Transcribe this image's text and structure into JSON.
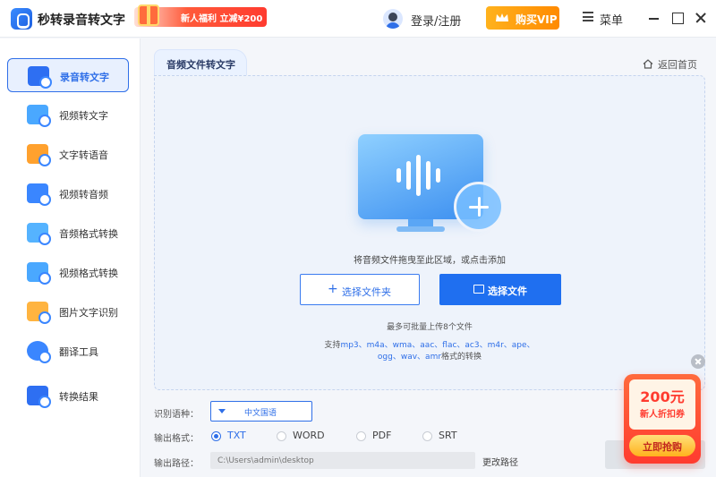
{
  "app": {
    "title": "秒转录音转文字",
    "promo_banner": "新人福利 立减¥200",
    "login_label": "登录/注册",
    "vip_label": "购买VIP",
    "menu_label": "菜单"
  },
  "colors": {
    "accent": "#2f6fe8",
    "vip": "#ffa20f",
    "promo": "#ff3b2f"
  },
  "sidebar": {
    "items": [
      {
        "label": "录音转文字",
        "icon": "audio-to-text-icon",
        "active": true
      },
      {
        "label": "视频转文字",
        "icon": "video-to-text-icon"
      },
      {
        "label": "文字转语音",
        "icon": "text-to-speech-icon"
      },
      {
        "label": "视频转音频",
        "icon": "video-to-audio-icon"
      },
      {
        "label": "音频格式转换",
        "icon": "audio-convert-icon"
      },
      {
        "label": "视频格式转换",
        "icon": "video-convert-icon"
      },
      {
        "label": "图片文字识别",
        "icon": "image-ocr-icon"
      },
      {
        "label": "翻译工具",
        "icon": "translate-icon"
      },
      {
        "label": "转换结果",
        "icon": "results-icon"
      }
    ]
  },
  "main": {
    "tab_label": "音频文件转文字",
    "back_home_label": "返回首页",
    "drop_hint": "将音频文件拖曳至此区域，或点击添加",
    "select_folder_label": "选择文件夹",
    "select_file_label": "选择文件",
    "limit_note": "最多可批量上传8个文件",
    "support_prefix": "支持",
    "support_formats_1": "mp3、m4a、wma、aac、flac、ac3、m4r、ape、",
    "support_formats_2": "ogg、wav、amr",
    "support_suffix": "格式的转换"
  },
  "settings": {
    "language_label": "识别语种：",
    "language_value": "中文国语",
    "format_label": "输出格式：",
    "formats": [
      "TXT",
      "WORD",
      "PDF",
      "SRT"
    ],
    "selected_format": "TXT",
    "path_label": "输出路径：",
    "path_placeholder": "C:\\Users\\admin\\desktop",
    "change_path_label": "更改路径"
  },
  "coupon": {
    "amount": "200元",
    "subtitle": "新人折扣券",
    "button_label": "立即抢购"
  }
}
